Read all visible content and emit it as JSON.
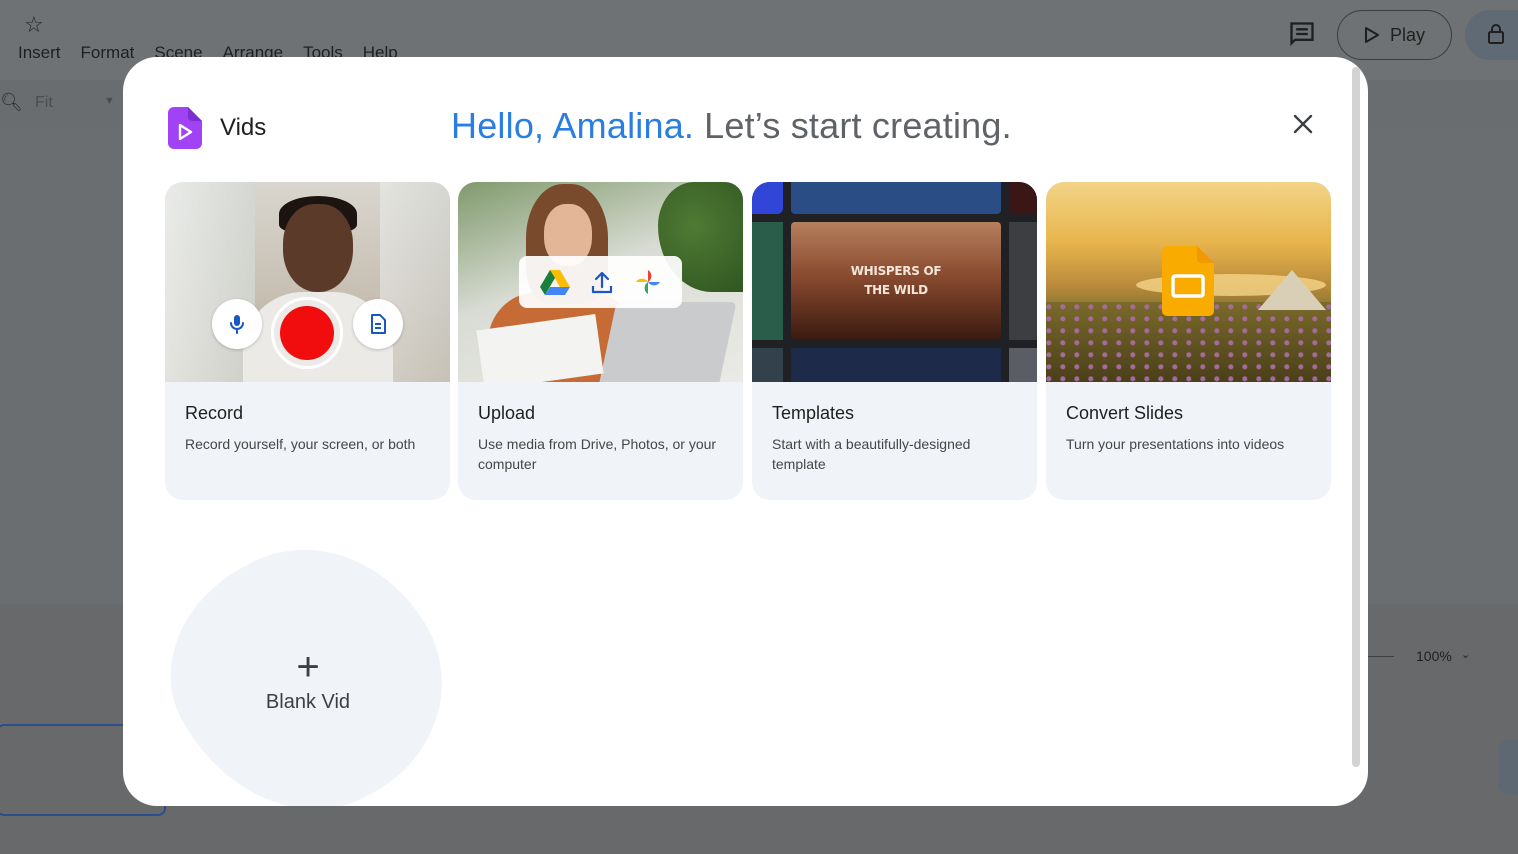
{
  "background": {
    "menu": [
      "Insert",
      "Format",
      "Scene",
      "Arrange",
      "Tools",
      "Help"
    ],
    "zoom_field": "Fit",
    "play_label": "Play",
    "timeline_zoom": "100%"
  },
  "dialog": {
    "brand_name": "Vids",
    "greeting_name": "Hello, Amalina.",
    "greeting_rest": "Let’s start creating.",
    "cards": [
      {
        "title": "Record",
        "description": "Record yourself, your screen, or both"
      },
      {
        "title": "Upload",
        "description": "Use media from Drive, Photos, or your computer"
      },
      {
        "title": "Templates",
        "description": "Start with a beautifully-designed template"
      },
      {
        "title": "Convert Slides",
        "description": "Turn your presentations into videos"
      }
    ],
    "template_thumb_text": [
      "WHISPERS OF",
      "THE WILD"
    ],
    "blank_label": "Blank Vid"
  },
  "colors": {
    "accent_blue": "#2a7de1",
    "record_red": "#f10d0d",
    "vids_purple": "#a142f4",
    "slides_yellow": "#f9ab00",
    "card_bg": "#f0f3f8"
  }
}
